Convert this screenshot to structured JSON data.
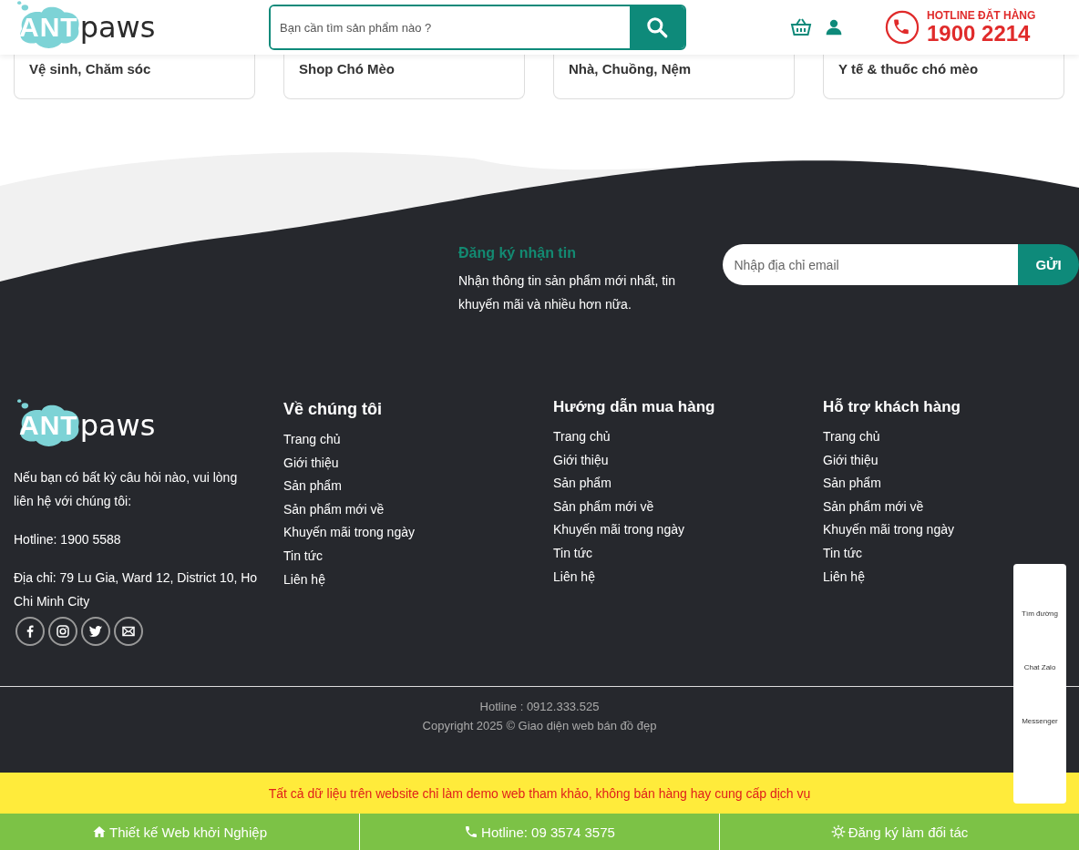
{
  "header": {
    "logo": {
      "mark": "ANT",
      "word": "paws"
    },
    "search": {
      "placeholder": "Bạn cần tìm sản phẩm nào ?"
    },
    "hotline": {
      "label": "HOTLINE ĐẶT HÀNG",
      "number": "1900 2214"
    }
  },
  "categories": [
    {
      "name": "Vệ sinh, Chăm sóc"
    },
    {
      "name": "Shop Chó Mèo"
    },
    {
      "name": "Nhà, Chuồng, Nệm"
    },
    {
      "name": "Y tế & thuốc chó mèo"
    }
  ],
  "newsletter": {
    "title": "Đăng ký nhận tin",
    "text": "Nhận thông tin sản phẩm mới nhất, tin khuyến mãi và nhiều hơn nữa.",
    "placeholder": "Nhập địa chỉ email",
    "button": "GỬI"
  },
  "about": {
    "logo": {
      "mark": "ANT",
      "word": "paws"
    },
    "text": "Nếu bạn có bất kỳ câu hỏi nào, vui lòng liên hệ với chúng tôi:",
    "hotline": "Hotline: 1900 5588",
    "address": "Địa chỉ: 79 Lu Gia, Ward 12, District 10, Ho Chi Minh City",
    "social": [
      {
        "kind": "facebook"
      },
      {
        "kind": "instagram"
      },
      {
        "kind": "twitter"
      },
      {
        "kind": "email"
      }
    ]
  },
  "columns": [
    {
      "title": "Về chúng tôi",
      "links": [
        "Trang chủ",
        "Giới thiệu",
        "Sản phẩm",
        "Sản phẩm mới về",
        "Khuyến mãi trong ngày",
        "Tin tức",
        "Liên hệ"
      ]
    },
    {
      "title": "Hướng dẫn mua hàng",
      "links": [
        "Trang chủ",
        "Giới thiệu",
        "Sản phẩm",
        "Sản phẩm mới về",
        "Khuyến mãi trong ngày",
        "Tin tức",
        "Liên hệ"
      ]
    },
    {
      "title": "Hỗ trợ khách hàng",
      "links": [
        "Trang chủ",
        "Giới thiệu",
        "Sản phẩm",
        "Sản phẩm mới về",
        "Khuyến mãi trong ngày",
        "Tin tức",
        "Liên hệ"
      ]
    }
  ],
  "bottom": {
    "hotline": "Hotline : 0912.333.525",
    "copyright": "Copyright 2025 © Giao diện web bán đồ đẹp"
  },
  "notice": "Tất cả dữ liệu trên website chỉ làm demo web tham khảo, không bán hàng hay cung cấp dịch vụ",
  "bottom_bar": [
    {
      "kind": "home",
      "label": "Thiết kế Web khởi Nghiệp"
    },
    {
      "kind": "phone",
      "label": "Hotline: 09 3574 3575"
    },
    {
      "kind": "gear",
      "label": "Đăng ký làm đối tác"
    }
  ],
  "side_widget": [
    {
      "label": "Tìm đường"
    },
    {
      "label": "Chat Zalo"
    },
    {
      "label": "Messenger"
    }
  ]
}
